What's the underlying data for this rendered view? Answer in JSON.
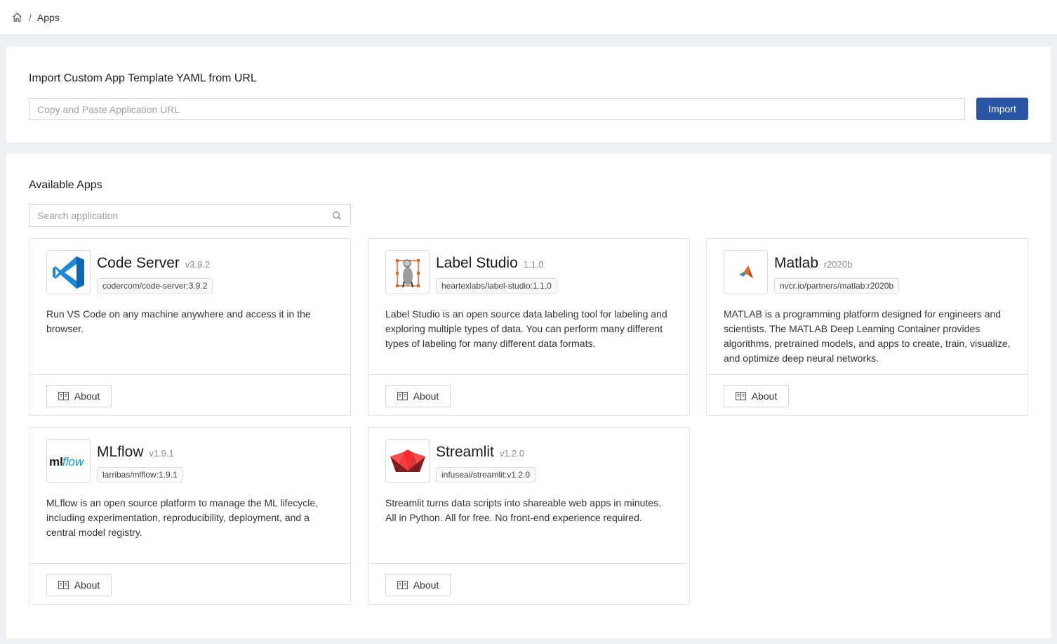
{
  "breadcrumb": {
    "current": "Apps",
    "separator": "/"
  },
  "import": {
    "title": "Import Custom App Template YAML from URL",
    "placeholder": "Copy and Paste Application URL",
    "value": "",
    "button_label": "Import"
  },
  "apps": {
    "title": "Available Apps",
    "search_placeholder": "Search application",
    "items": [
      {
        "name": "Code Server",
        "version": "v3.9.2",
        "image": "codercom/code-server:3.9.2",
        "description": "Run VS Code on any machine anywhere and access it in the browser.",
        "logo": "vscode-logo-icon",
        "about_label": "About"
      },
      {
        "name": "Label Studio",
        "version": "1.1.0",
        "image": "heartexlabs/label-studio:1.1.0",
        "description": "Label Studio is an open source data labeling tool for labeling and exploring multiple types of data. You can perform many different types of labeling for many different data formats.",
        "logo": "label-studio-logo-icon",
        "about_label": "About"
      },
      {
        "name": "Matlab",
        "version": "r2020b",
        "image": "nvcr.io/partners/matlab:r2020b",
        "description": "MATLAB is a programming platform designed for engineers and scientists. The MATLAB Deep Learning Container provides algorithms, pretrained models, and apps to create, train, visualize, and optimize deep neural networks.",
        "logo": "matlab-logo-icon",
        "about_label": "About"
      },
      {
        "name": "MLflow",
        "version": "v1.9.1",
        "image": "larribas/mlflow:1.9.1",
        "description": "MLflow is an open source platform to manage the ML lifecycle, including experimentation, reproducibility, deployment, and a central model registry.",
        "logo": "mlflow-logo-icon",
        "about_label": "About"
      },
      {
        "name": "Streamlit",
        "version": "v1.2.0",
        "image": "infuseai/streamlit:v1.2.0",
        "description": "Streamlit turns data scripts into shareable web apps in minutes. All in Python. All for free. No front-end experience required.",
        "logo": "streamlit-logo-icon",
        "about_label": "About"
      }
    ]
  },
  "colors": {
    "primary": "#2a55a6",
    "background": "#eef0f3"
  }
}
